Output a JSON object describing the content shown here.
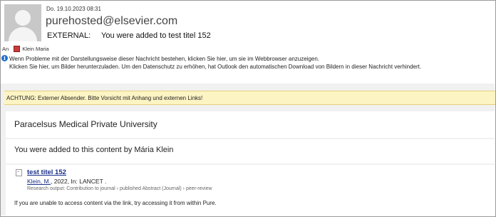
{
  "header": {
    "date": "Do. 19.10.2023 08:31",
    "sender": "purehosted@elsevier.com",
    "subject_prefix": "EXTERNAL:",
    "subject_text": "You were added to test titel 152",
    "to_label": "An",
    "recipient": "Klein Maria"
  },
  "info": {
    "line1": "Wenn Probleme mit der Darstellungsweise dieser Nachricht bestehen, klicken Sie hier, um sie im Webbrowser anzuzeigen.",
    "line2": "Klicken Sie hier, um Bilder herunterzuladen. Um den Datenschutz zu erhöhen, hat Outlook den automatischen Download von Bildern in dieser Nachricht verhindert."
  },
  "warning": {
    "text": "ACHTUNG: Externer Absender. Bitte Vorsicht mit Anhang und externen Links!",
    "color": "#fdf4c4"
  },
  "body": {
    "university": "Paracelsus Medical Private University",
    "added_to": "You were added to this content by Mária Klein",
    "item": {
      "title": "test titel 152",
      "author": "Klein, M.",
      "citation": ", 2022, In: LANCET .",
      "meta": "Research output: Contribution to journal › published Abstract (Journal) › peer-review"
    },
    "footer_note": "If you are unable to access content via the link, try accessing it from within Pure."
  },
  "colors": {
    "link": "#1a2f8a",
    "info_icon": "#1f6fd1"
  }
}
